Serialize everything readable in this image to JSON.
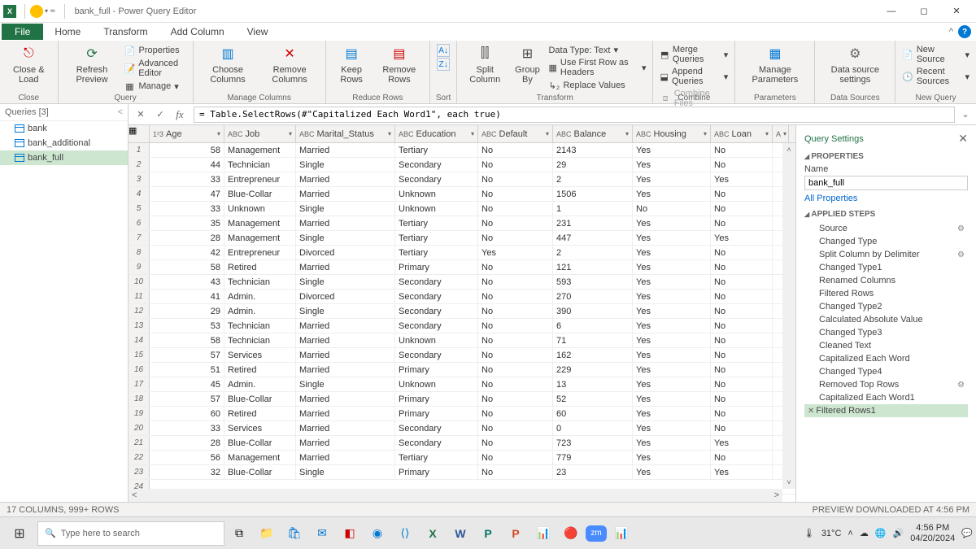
{
  "titlebar": {
    "app": "X",
    "title": "bank_full - Power Query Editor"
  },
  "menu": {
    "file": "File",
    "home": "Home",
    "transform": "Transform",
    "addcol": "Add Column",
    "view": "View"
  },
  "ribbon": {
    "close": {
      "close_load": "Close &\nLoad",
      "group": "Close"
    },
    "query": {
      "refresh": "Refresh\nPreview",
      "properties": "Properties",
      "advanced": "Advanced Editor",
      "manage": "Manage",
      "group": "Query"
    },
    "managecols": {
      "choose": "Choose\nColumns",
      "remove": "Remove\nColumns",
      "group": "Manage Columns"
    },
    "reducerows": {
      "keep": "Keep\nRows",
      "remove": "Remove\nRows",
      "group": "Reduce Rows"
    },
    "sort": {
      "group": "Sort"
    },
    "transform": {
      "split": "Split\nColumn",
      "groupby": "Group\nBy",
      "datatype": "Data Type: Text",
      "firstrow": "Use First Row as Headers",
      "replace": "Replace Values",
      "group": "Transform"
    },
    "combine": {
      "merge": "Merge Queries",
      "append": "Append Queries",
      "combine": "Combine Files",
      "group": "Combine"
    },
    "params": {
      "manage": "Manage\nParameters",
      "group": "Parameters"
    },
    "datasrc": {
      "settings": "Data source\nsettings",
      "group": "Data Sources"
    },
    "newquery": {
      "new": "New Source",
      "recent": "Recent Sources",
      "group": "New Query"
    }
  },
  "fx": {
    "formula": "= Table.SelectRows(#\"Capitalized Each Word1\", each true)"
  },
  "queries": {
    "header": "Queries [3]",
    "items": [
      "bank",
      "bank_additional",
      "bank_full"
    ],
    "selected": 2
  },
  "columns": [
    {
      "name": "Age",
      "type": "1²3",
      "cls": "c-age",
      "num": true
    },
    {
      "name": "Job",
      "type": "ABC",
      "cls": "c-job"
    },
    {
      "name": "Marital_Status",
      "type": "ABC",
      "cls": "c-ms"
    },
    {
      "name": "Education",
      "type": "ABC",
      "cls": "c-edu"
    },
    {
      "name": "Default",
      "type": "ABC",
      "cls": "c-def"
    },
    {
      "name": "Balance",
      "type": "ABC",
      "cls": "c-bal"
    },
    {
      "name": "Housing",
      "type": "ABC",
      "cls": "c-hou"
    },
    {
      "name": "Loan",
      "type": "ABC",
      "cls": "c-loan"
    }
  ],
  "rows": [
    [
      "58",
      "Management",
      "Married",
      "Tertiary",
      "No",
      "2143",
      "Yes",
      "No"
    ],
    [
      "44",
      "Technician",
      "Single",
      "Secondary",
      "No",
      "29",
      "Yes",
      "No"
    ],
    [
      "33",
      "Entrepreneur",
      "Married",
      "Secondary",
      "No",
      "2",
      "Yes",
      "Yes"
    ],
    [
      "47",
      "Blue-Collar",
      "Married",
      "Unknown",
      "No",
      "1506",
      "Yes",
      "No"
    ],
    [
      "33",
      "Unknown",
      "Single",
      "Unknown",
      "No",
      "1",
      "No",
      "No"
    ],
    [
      "35",
      "Management",
      "Married",
      "Tertiary",
      "No",
      "231",
      "Yes",
      "No"
    ],
    [
      "28",
      "Management",
      "Single",
      "Tertiary",
      "No",
      "447",
      "Yes",
      "Yes"
    ],
    [
      "42",
      "Entrepreneur",
      "Divorced",
      "Tertiary",
      "Yes",
      "2",
      "Yes",
      "No"
    ],
    [
      "58",
      "Retired",
      "Married",
      "Primary",
      "No",
      "121",
      "Yes",
      "No"
    ],
    [
      "43",
      "Technician",
      "Single",
      "Secondary",
      "No",
      "593",
      "Yes",
      "No"
    ],
    [
      "41",
      "Admin.",
      "Divorced",
      "Secondary",
      "No",
      "270",
      "Yes",
      "No"
    ],
    [
      "29",
      "Admin.",
      "Single",
      "Secondary",
      "No",
      "390",
      "Yes",
      "No"
    ],
    [
      "53",
      "Technician",
      "Married",
      "Secondary",
      "No",
      "6",
      "Yes",
      "No"
    ],
    [
      "58",
      "Technician",
      "Married",
      "Unknown",
      "No",
      "71",
      "Yes",
      "No"
    ],
    [
      "57",
      "Services",
      "Married",
      "Secondary",
      "No",
      "162",
      "Yes",
      "No"
    ],
    [
      "51",
      "Retired",
      "Married",
      "Primary",
      "No",
      "229",
      "Yes",
      "No"
    ],
    [
      "45",
      "Admin.",
      "Single",
      "Unknown",
      "No",
      "13",
      "Yes",
      "No"
    ],
    [
      "57",
      "Blue-Collar",
      "Married",
      "Primary",
      "No",
      "52",
      "Yes",
      "No"
    ],
    [
      "60",
      "Retired",
      "Married",
      "Primary",
      "No",
      "60",
      "Yes",
      "No"
    ],
    [
      "33",
      "Services",
      "Married",
      "Secondary",
      "No",
      "0",
      "Yes",
      "No"
    ],
    [
      "28",
      "Blue-Collar",
      "Married",
      "Secondary",
      "No",
      "723",
      "Yes",
      "Yes"
    ],
    [
      "56",
      "Management",
      "Married",
      "Tertiary",
      "No",
      "779",
      "Yes",
      "No"
    ],
    [
      "32",
      "Blue-Collar",
      "Single",
      "Primary",
      "No",
      "23",
      "Yes",
      "Yes"
    ]
  ],
  "settings": {
    "title": "Query Settings",
    "props": "PROPERTIES",
    "name_lbl": "Name",
    "name_val": "bank_full",
    "allprops": "All Properties",
    "steps_lbl": "APPLIED STEPS",
    "steps": [
      "Source",
      "Changed Type",
      "Split Column by Delimiter",
      "Changed Type1",
      "Renamed Columns",
      "Filtered Rows",
      "Changed Type2",
      "Calculated Absolute Value",
      "Changed Type3",
      "Cleaned Text",
      "Capitalized Each Word",
      "Changed Type4",
      "Removed Top Rows",
      "Capitalized Each Word1",
      "Filtered Rows1"
    ],
    "gears": [
      0,
      2,
      12
    ],
    "selected": 14
  },
  "status": {
    "left": "17 COLUMNS, 999+ ROWS",
    "right": "PREVIEW DOWNLOADED AT 4:56 PM"
  },
  "taskbar": {
    "search": "Type here to search",
    "temp": "31°C",
    "time": "4:56 PM",
    "date": "04/20/2024"
  }
}
